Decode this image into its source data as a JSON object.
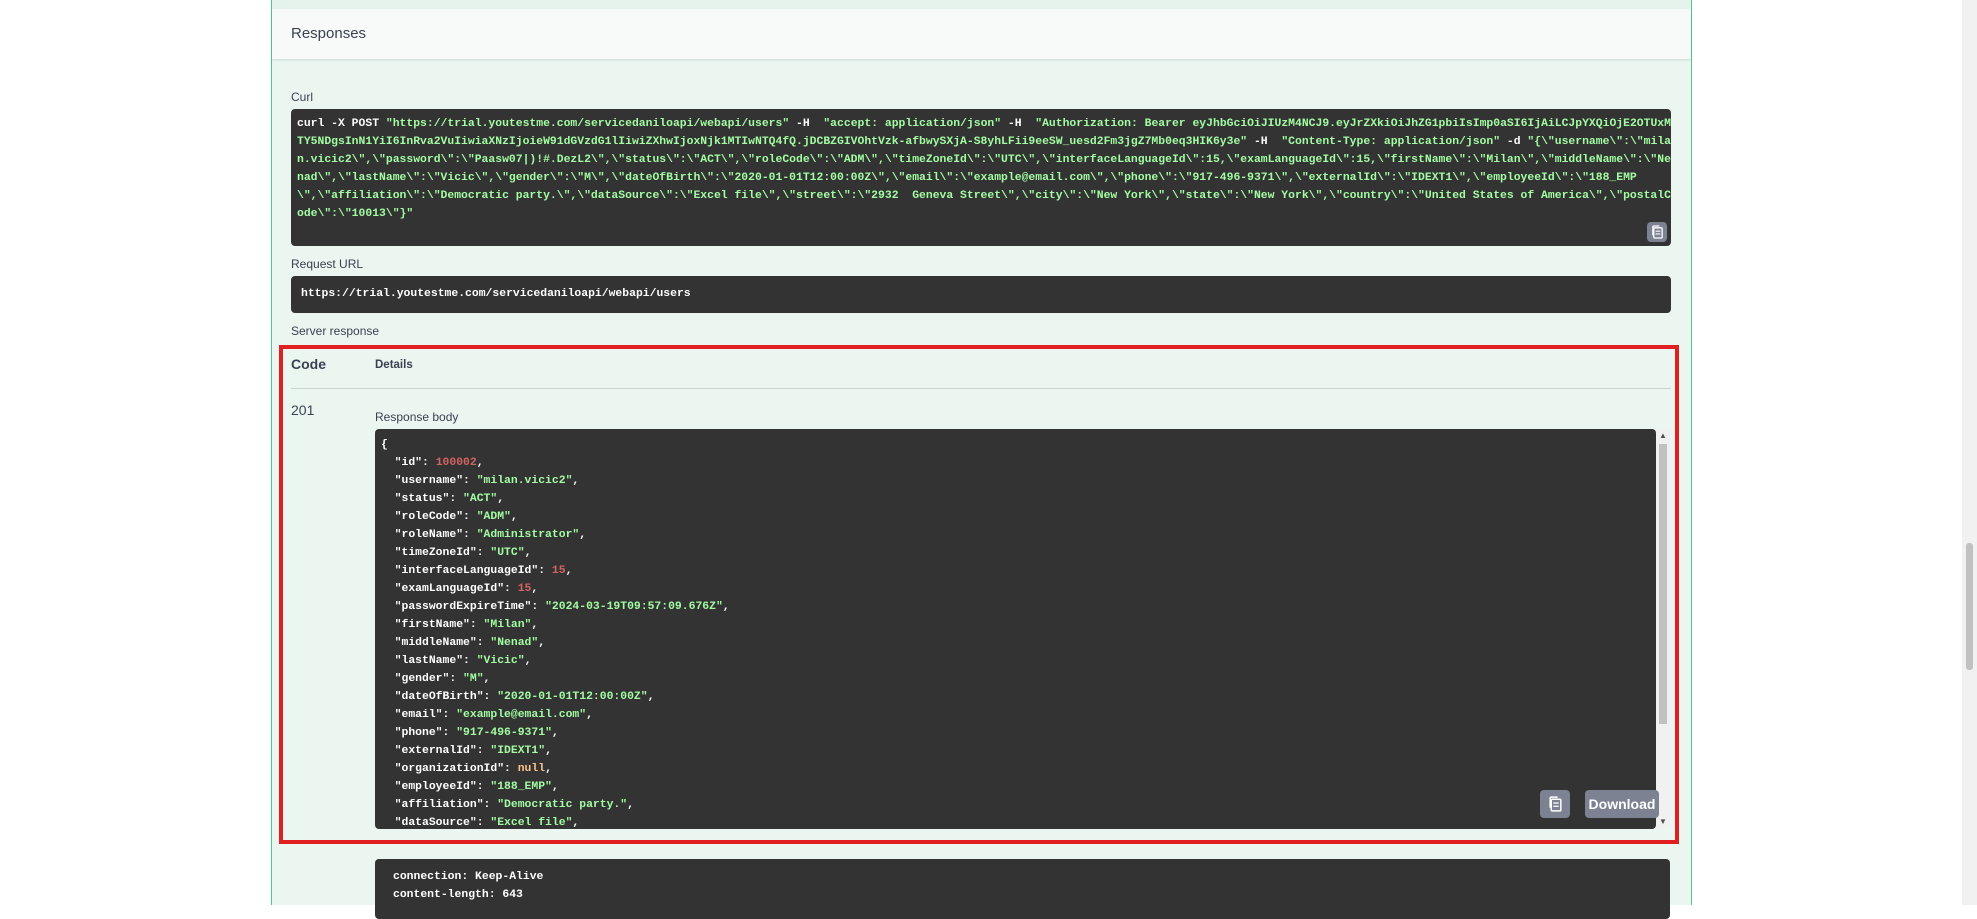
{
  "responses": {
    "title": "Responses"
  },
  "curl": {
    "label": "Curl",
    "command": "curl -X POST ",
    "url": "\"https://trial.youtestme.com/servicedaniloapi/webapi/users\"",
    "h1_flag": " -H ",
    "h1": " \"accept: application/json\"",
    "h2_flag": " -H ",
    "h2": " \"Authorization: Bearer eyJhbGciOiJIUzM4NCJ9.eyJrZXkiOiJhZG1pbiIsImp0aSI6IjAiLCJpYXQiOjE2OTUxMTY5NDgsInN1YiI6InRva2VuIiwiaXNzIjoieW91dGVzdG1lIiwiZXhwIjoxNjk1MTIwNTQ4fQ.jDCBZGIVOhtVzk-afbwySXjA-S8yhLFii9eeSW_uesd2Fm3jgZ7Mb0eq3HIK6y3e\"",
    "h3_flag": " -H ",
    "h3": " \"Content-Type: application/json\"",
    "d_flag": " -d ",
    "d": "\"{\\\"username\\\":\\\"milan.vicic2\\\",\\\"password\\\":\\\"Paasw07|)!#.DezL2\\\",\\\"status\\\":\\\"ACT\\\",\\\"roleCode\\\":\\\"ADM\\\",\\\"timeZoneId\\\":\\\"UTC\\\",\\\"interfaceLanguageId\\\":15,\\\"examLanguageId\\\":15,\\\"firstName\\\":\\\"Milan\\\",\\\"middleName\\\":\\\"Nenad\\\",\\\"lastName\\\":\\\"Vicic\\\",\\\"gender\\\":\\\"M\\\",\\\"dateOfBirth\\\":\\\"2020-01-01T12:00:00Z\\\",\\\"email\\\":\\\"example@email.com\\\",\\\"phone\\\":\\\"917-496-9371\\\",\\\"externalId\\\":\\\"IDEXT1\\\",\\\"employeeId\\\":\\\"188_EMP\\\",\\\"affiliation\\\":\\\"Democratic party.\\\",\\\"dataSource\\\":\\\"Excel file\\\",\\\"street\\\":\\\"2932  Geneva Street\\\",\\\"city\\\":\\\"New York\\\",\\\"state\\\":\\\"New York\\\",\\\"country\\\":\\\"United States of America\\\",\\\"postalCode\\\":\\\"10013\\\"}\"",
    "copy_icon": "copy-icon"
  },
  "request_url": {
    "label": "Request URL",
    "value": "https://trial.youtestme.com/servicedaniloapi/webapi/users"
  },
  "server_response": {
    "label": "Server response",
    "col_code": "Code",
    "col_details": "Details",
    "status_code": "201",
    "body_label": "Response body",
    "body": {
      "open_brace": "{",
      "lines": [
        {
          "key": "\"id\"",
          "value": "100002",
          "type": "number"
        },
        {
          "key": "\"username\"",
          "value": "\"milan.vicic2\"",
          "type": "string"
        },
        {
          "key": "\"status\"",
          "value": "\"ACT\"",
          "type": "string"
        },
        {
          "key": "\"roleCode\"",
          "value": "\"ADM\"",
          "type": "string"
        },
        {
          "key": "\"roleName\"",
          "value": "\"Administrator\"",
          "type": "string"
        },
        {
          "key": "\"timeZoneId\"",
          "value": "\"UTC\"",
          "type": "string"
        },
        {
          "key": "\"interfaceLanguageId\"",
          "value": "15",
          "type": "number"
        },
        {
          "key": "\"examLanguageId\"",
          "value": "15",
          "type": "number"
        },
        {
          "key": "\"passwordExpireTime\"",
          "value": "\"2024-03-19T09:57:09.676Z\"",
          "type": "string"
        },
        {
          "key": "\"firstName\"",
          "value": "\"Milan\"",
          "type": "string"
        },
        {
          "key": "\"middleName\"",
          "value": "\"Nenad\"",
          "type": "string"
        },
        {
          "key": "\"lastName\"",
          "value": "\"Vicic\"",
          "type": "string"
        },
        {
          "key": "\"gender\"",
          "value": "\"M\"",
          "type": "string"
        },
        {
          "key": "\"dateOfBirth\"",
          "value": "\"2020-01-01T12:00:00Z\"",
          "type": "string"
        },
        {
          "key": "\"email\"",
          "value": "\"example@email.com\"",
          "type": "string"
        },
        {
          "key": "\"phone\"",
          "value": "\"917-496-9371\"",
          "type": "string"
        },
        {
          "key": "\"externalId\"",
          "value": "\"IDEXT1\"",
          "type": "string"
        },
        {
          "key": "\"organizationId\"",
          "value": "null",
          "type": "null"
        },
        {
          "key": "\"employeeId\"",
          "value": "\"188_EMP\"",
          "type": "string"
        },
        {
          "key": "\"affiliation\"",
          "value": "\"Democratic party.\"",
          "type": "string"
        },
        {
          "key": "\"dataSource\"",
          "value": "\"Excel file\"",
          "type": "string"
        }
      ]
    },
    "download_label": "Download",
    "copy_icon": "copy-icon",
    "headers": [
      "connection: Keep-Alive",
      "content-length: 643"
    ]
  },
  "colors": {
    "panel_bg": "#ebf6f0",
    "panel_border": "#49cc90",
    "code_bg": "#333333",
    "string_color": "#a2fca2",
    "number_color": "#d36363",
    "null_color": "#fcc28c",
    "highlight_border": "#e02020",
    "button_bg": "#7d8293"
  }
}
